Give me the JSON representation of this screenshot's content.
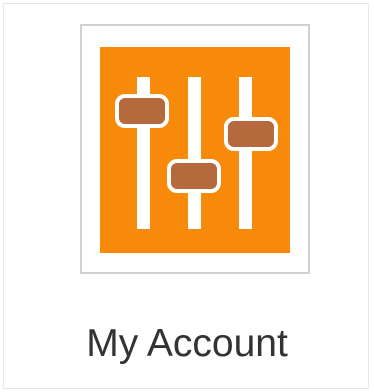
{
  "tile": {
    "label": "My Account",
    "icon": "sliders-settings-icon",
    "colors": {
      "icon_background": "#f7890b",
      "slider_knob": "#b5693d",
      "slider_track": "#ffffff",
      "label_text": "#333333"
    }
  }
}
